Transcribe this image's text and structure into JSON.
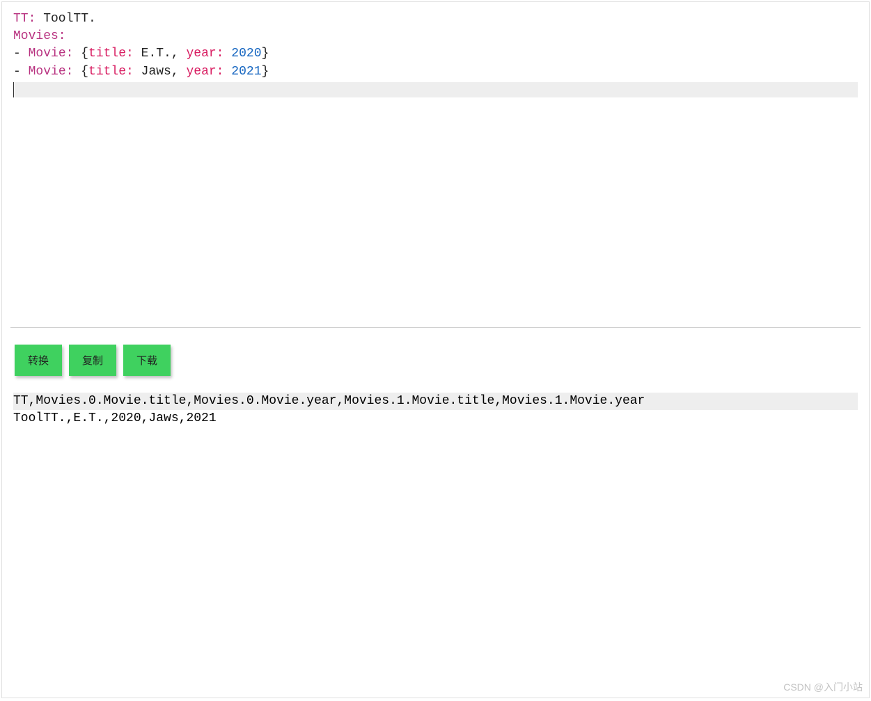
{
  "editor": {
    "line1": {
      "key": "TT:",
      "value": " ToolTT."
    },
    "line2": {
      "key": "Movies:"
    },
    "line3": {
      "dash": "- ",
      "movie_key": "Movie:",
      "brace_open": " {",
      "title_key": "title:",
      "title_val": " E.T., ",
      "year_key": "year:",
      "year_val": " 2020",
      "brace_close": "}"
    },
    "line4": {
      "dash": "- ",
      "movie_key": "Movie:",
      "brace_open": " {",
      "title_key": "title:",
      "title_val": " Jaws, ",
      "year_key": "year:",
      "year_val": " 2021",
      "brace_close": "}"
    }
  },
  "buttons": {
    "convert": "转换",
    "copy": "复制",
    "download": "下载"
  },
  "output": {
    "line1": "TT,Movies.0.Movie.title,Movies.0.Movie.year,Movies.1.Movie.title,Movies.1.Movie.year",
    "line2": "ToolTT.,E.T.,2020,Jaws,2021"
  },
  "watermark": "CSDN @入门小站"
}
